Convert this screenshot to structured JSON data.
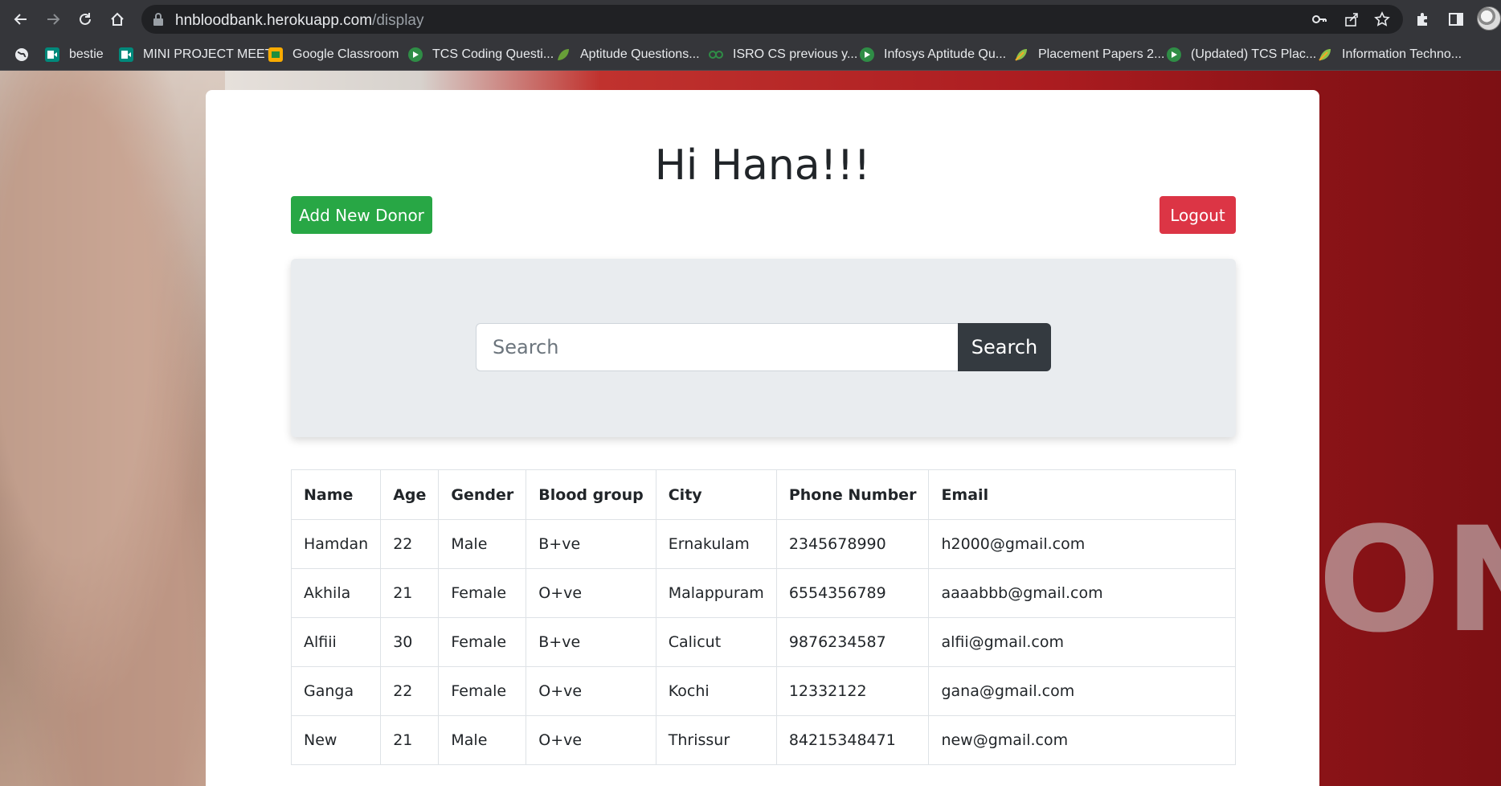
{
  "browser": {
    "url_host": "hnbloodbank.herokuapp.com",
    "url_path": "/display",
    "bookmarks": [
      {
        "label": "bestie",
        "icon": "meet-icon",
        "color": "#00897b"
      },
      {
        "label": "MINI PROJECT MEET",
        "icon": "meet-icon",
        "color": "#00897b"
      },
      {
        "label": "Google Classroom",
        "icon": "classroom-icon",
        "color": "#f9ab00"
      },
      {
        "label": "TCS Coding Questi...",
        "icon": "gfg-icon",
        "color": "#2f8d46"
      },
      {
        "label": "Aptitude Questions...",
        "icon": "leaf-icon",
        "color": "#689f38"
      },
      {
        "label": "ISRO CS previous y...",
        "icon": "gfg-icon",
        "color": "#2f8d46"
      },
      {
        "label": "Infosys Aptitude Qu...",
        "icon": "gfg-icon",
        "color": "#2f8d46"
      },
      {
        "label": "Placement Papers 2...",
        "icon": "leaf-icon",
        "color": "#8bc34a"
      },
      {
        "label": "(Updated) TCS Plac...",
        "icon": "gfg-icon",
        "color": "#2f8d46"
      },
      {
        "label": "Information Techno...",
        "icon": "leaf-icon",
        "color": "#8bc34a"
      }
    ]
  },
  "page": {
    "greeting": "Hi Hana!!!",
    "add_button": "Add New Donor",
    "logout_button": "Logout",
    "search_placeholder": "Search",
    "search_button": "Search",
    "background_text": "ON"
  },
  "table": {
    "headers": [
      "Name",
      "Age",
      "Gender",
      "Blood group",
      "City",
      "Phone Number",
      "Email"
    ],
    "rows": [
      [
        "Hamdan",
        "22",
        "Male",
        "B+ve",
        "Ernakulam",
        "2345678990",
        "h2000@gmail.com"
      ],
      [
        "Akhila",
        "21",
        "Female",
        "O+ve",
        "Malappuram",
        "6554356789",
        "aaaabbb@gmail.com"
      ],
      [
        "Alfiii",
        "30",
        "Female",
        "B+ve",
        "Calicut",
        "9876234587",
        "alfii@gmail.com"
      ],
      [
        "Ganga",
        "22",
        "Female",
        "O+ve",
        "Kochi",
        "12332122",
        "gana@gmail.com"
      ],
      [
        "New",
        "21",
        "Male",
        "O+ve",
        "Thrissur",
        "84215348471",
        "new@gmail.com"
      ]
    ]
  },
  "colors": {
    "add_button": "#28a745",
    "logout_button": "#dc3545",
    "search_button": "#343a40"
  }
}
